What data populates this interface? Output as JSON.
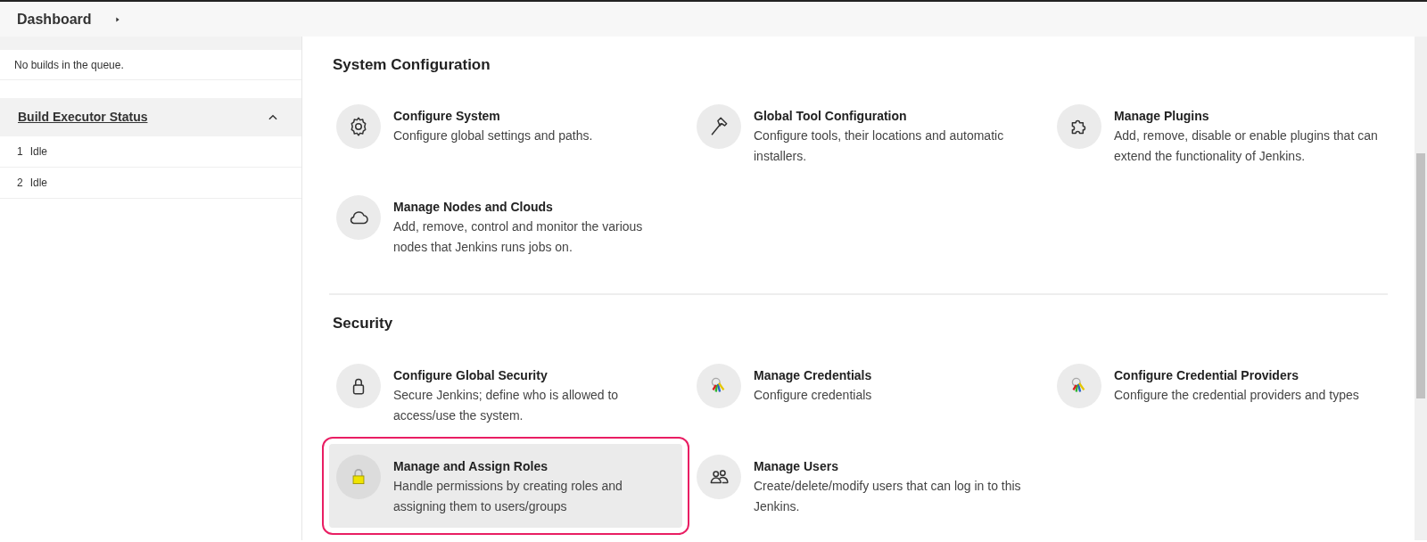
{
  "breadcrumb": {
    "items": [
      "Dashboard"
    ]
  },
  "sidebar": {
    "queue_message": "No builds in the queue.",
    "executor_panel": {
      "title": "Build Executor Status",
      "expanded": true,
      "executors": [
        {
          "number": "1",
          "status": "Idle"
        },
        {
          "number": "2",
          "status": "Idle"
        }
      ]
    }
  },
  "sections": [
    {
      "title": "System Configuration",
      "items": [
        {
          "kind": "gear",
          "title": "Configure System",
          "description": "Configure global settings and paths.",
          "selected": false
        },
        {
          "kind": "hammer",
          "title": "Global Tool Configuration",
          "description": "Configure tools, their locations and automatic installers.",
          "selected": false
        },
        {
          "kind": "puzzle",
          "title": "Manage Plugins",
          "description": "Add, remove, disable or enable plugins that can extend the functionality of Jenkins.",
          "selected": false
        },
        {
          "kind": "cloud",
          "title": "Manage Nodes and Clouds",
          "description": "Add, remove, control and monitor the various nodes that Jenkins runs jobs on.",
          "selected": false
        }
      ]
    },
    {
      "title": "Security",
      "items": [
        {
          "kind": "lock",
          "title": "Configure Global Security",
          "description": "Secure Jenkins; define who is allowed to access/use the system.",
          "selected": false
        },
        {
          "kind": "keys",
          "title": "Manage Credentials",
          "description": "Configure credentials",
          "selected": false
        },
        {
          "kind": "keys",
          "title": "Configure Credential Providers",
          "description": "Configure the credential providers and types",
          "selected": false
        },
        {
          "kind": "padlock",
          "title": "Manage and Assign Roles",
          "description": "Handle permissions by creating roles and assigning them to users/groups",
          "selected": true
        },
        {
          "kind": "users",
          "title": "Manage Users",
          "description": "Create/delete/modify users that can log in to this Jenkins.",
          "selected": false
        }
      ]
    }
  ]
}
